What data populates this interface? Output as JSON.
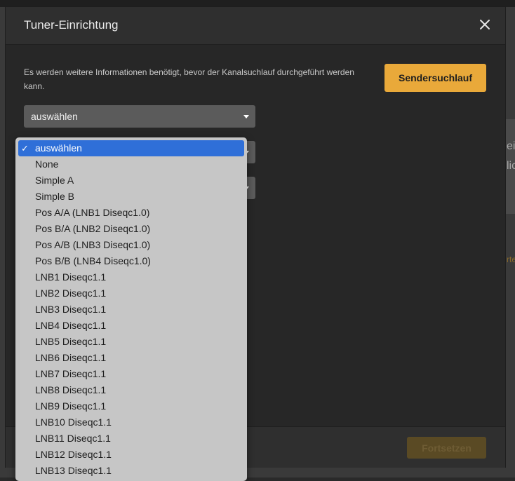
{
  "dialog": {
    "title": "Tuner-Einrichtung",
    "info": "Es werden weitere Informationen benötigt, bevor der Kanalsuchlauf durchgeführt werden kann.",
    "scan_button": "Sendersuchlauf",
    "continue_button": "Fortsetzen",
    "select_value": "auswählen"
  },
  "background": {
    "text1": "ei",
    "text2": "lic",
    "link": "rte"
  },
  "dropdown": {
    "check_glyph": "✓",
    "options": [
      "auswählen",
      "None",
      "Simple A",
      "Simple B",
      "Pos A/A (LNB1 Diseqc1.0)",
      "Pos B/A (LNB2 Diseqc1.0)",
      "Pos A/B (LNB3 Diseqc1.0)",
      "Pos B/B (LNB4 Diseqc1.0)",
      "LNB1 Diseqc1.1",
      "LNB2 Diseqc1.1",
      "LNB3 Diseqc1.1",
      "LNB4 Diseqc1.1",
      "LNB5 Diseqc1.1",
      "LNB6 Diseqc1.1",
      "LNB7 Diseqc1.1",
      "LNB8 Diseqc1.1",
      "LNB9 Diseqc1.1",
      "LNB10 Diseqc1.1",
      "LNB11 Diseqc1.1",
      "LNB12 Diseqc1.1",
      "LNB13 Diseqc1.1"
    ]
  },
  "colors": {
    "accent": "#e9a93a",
    "selection": "#2f6fd8"
  }
}
